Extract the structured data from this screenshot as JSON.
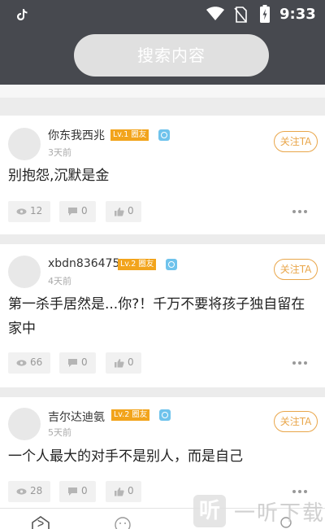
{
  "status_bar": {
    "time": "9:33"
  },
  "search": {
    "placeholder": "搜索内容"
  },
  "posts": [
    {
      "username": "你东我西兆",
      "level_badge": "Lv.1 圈友",
      "time_ago": "3天前",
      "follow_label": "关注TA",
      "content": "别抱怨,沉默是金",
      "views": "12",
      "comments": "0",
      "likes": "0"
    },
    {
      "username": "xbdn836475",
      "level_badge": "Lv.2 圈友",
      "time_ago": "4天前",
      "follow_label": "关注TA",
      "content": "第一杀手居然是...你?！千万不要将孩子独自留在家中",
      "views": "66",
      "comments": "0",
      "likes": "0"
    },
    {
      "username": "吉尔达迪氨",
      "level_badge": "Lv.2 圈友",
      "time_ago": "5天前",
      "follow_label": "关注TA",
      "content": "一个人最大的对手不是别人，而是自己",
      "views": "28",
      "comments": "0",
      "likes": "0"
    }
  ],
  "watermark": {
    "logo_char": "听",
    "text": "一听下载"
  },
  "colors": {
    "header_bg": "#47494f",
    "accent_orange": "#f2a41c",
    "follow_orange": "#e9a64a",
    "verified_blue": "#6fc3ec"
  },
  "icons": [
    "tiktok-icon",
    "wifi-icon",
    "no-sim-icon",
    "battery-icon",
    "eye-icon",
    "comment-icon",
    "thumbs-up-icon",
    "more-icon",
    "verified-icon"
  ]
}
